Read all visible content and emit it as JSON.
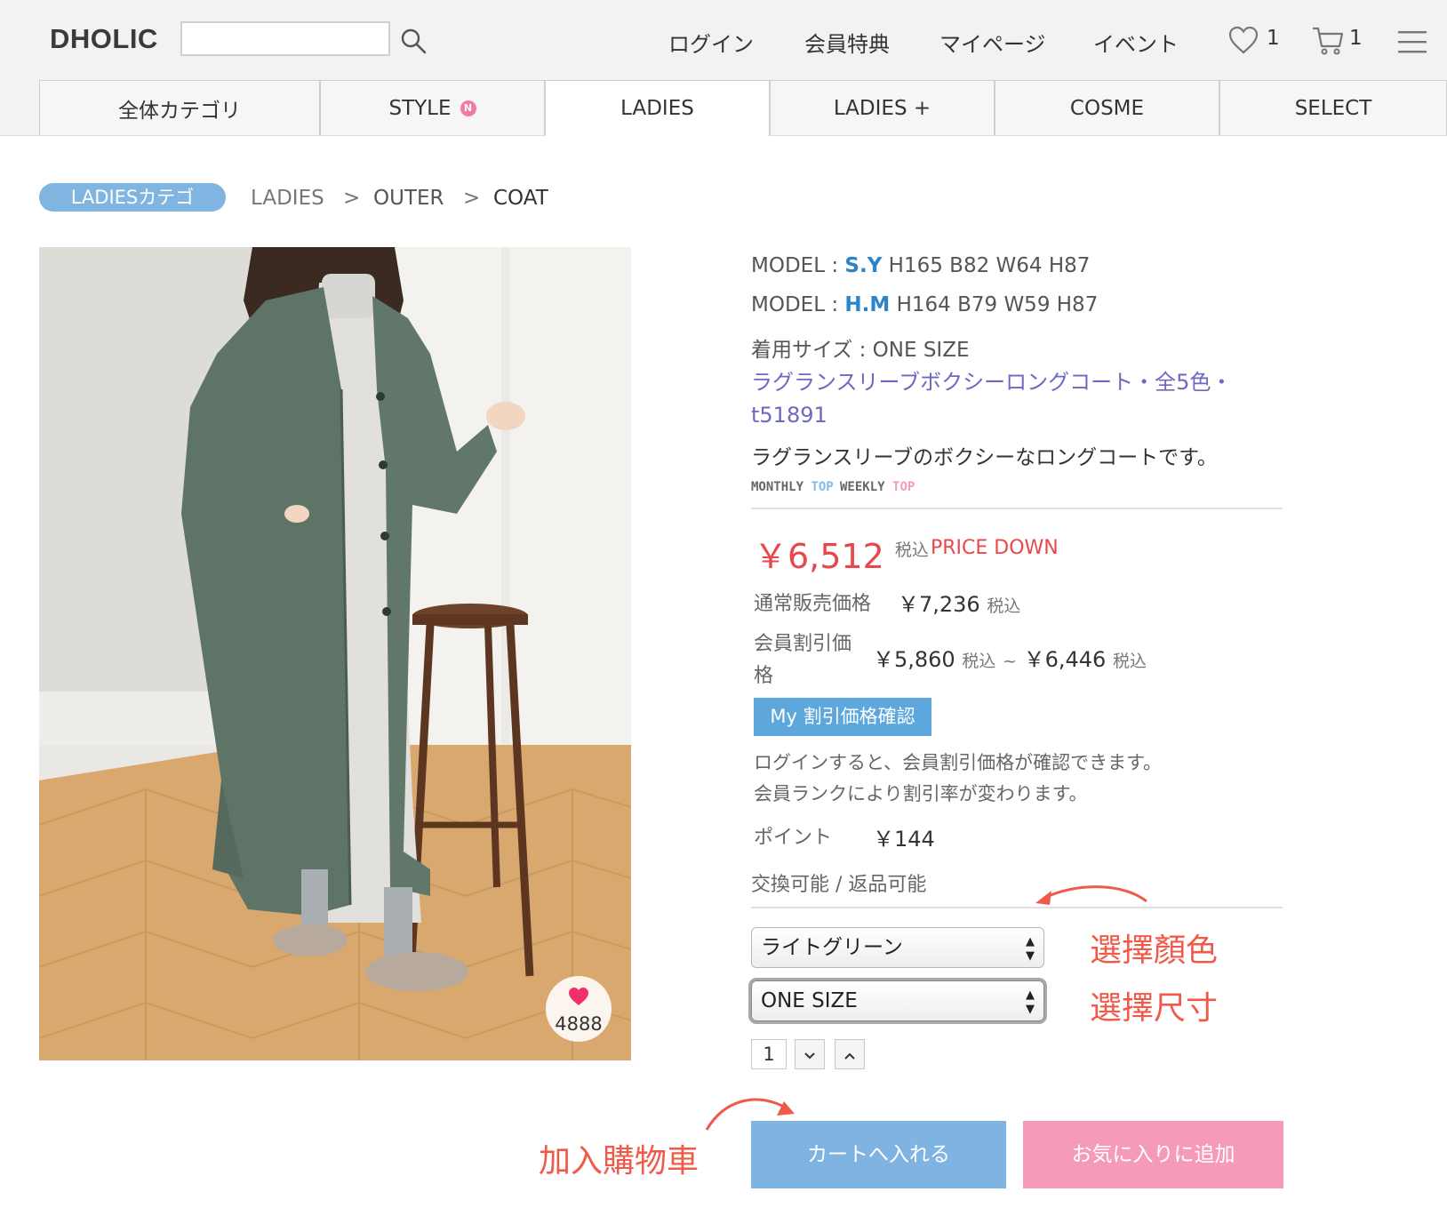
{
  "header": {
    "logo": "DHOLIC",
    "search_placeholder": "",
    "nav": [
      "ログイン",
      "会員特典",
      "マイページ",
      "イベント"
    ],
    "wishlist_count": "1",
    "cart_count": "1"
  },
  "categories": {
    "tabs": [
      "全体カテゴリ",
      "STYLE",
      "LADIES",
      "LADIES +",
      "COSME",
      "SELECT"
    ],
    "style_badge": "N",
    "active": "LADIES"
  },
  "breadcrumb": {
    "pill": "LADIESカテゴ",
    "items": [
      "LADIES",
      "OUTER",
      "COAT"
    ],
    "separator": ">"
  },
  "product": {
    "likes": "4888",
    "model1_prefix": "MODEL :",
    "model1_name": "S.Y",
    "model1_size": "H165 B82 W64 H87",
    "model2_prefix": "MODEL :",
    "model2_name": "H.M",
    "model2_size": "H164 B79 W59 H87",
    "wear_size": "着用サイズ : ONE SIZE",
    "title": "ラグランスリーブボクシーロングコート・全5色・t51891",
    "description": "ラグランスリーブのボクシーなロングコートです。",
    "rank_monthly": "MONTHLY",
    "rank_weekly": "WEEKLY",
    "rank_top": "TOP"
  },
  "price": {
    "current": "￥6,512",
    "tax": "税込",
    "badge": "PRICE DOWN",
    "regular_label": "通常販売価格",
    "regular_value": "￥7,236",
    "member_label_line1": "会員割引価",
    "member_label_line2": "格",
    "member_min": "￥5,860",
    "member_range_sep": "~",
    "member_max": "￥6,446",
    "my_discount_button": "My 割引価格確認",
    "login_note_1": "ログインすると、会員割引価格が確認できます。",
    "login_note_2": "会員ランクにより割引率が変わります。",
    "point_label": "ポイント",
    "point_value": "￥144",
    "exchange_note": "交換可能 / 返品可能"
  },
  "options": {
    "color_selected": "ライトグリーン",
    "size_selected": "ONE SIZE",
    "quantity": "1"
  },
  "annotations": {
    "color": "選擇顏色",
    "size": "選擇尺寸",
    "cart": "加入購物車"
  },
  "buttons": {
    "add_to_cart": "カートへ入れる",
    "add_to_favorites": "お気に入りに追加"
  },
  "colors": {
    "price_red": "#e8474c",
    "accent_blue": "#7fb3e1",
    "favorite_pink": "#f59ab8",
    "annotation_red": "#f05a4a",
    "title_purple": "#6d68c0"
  }
}
